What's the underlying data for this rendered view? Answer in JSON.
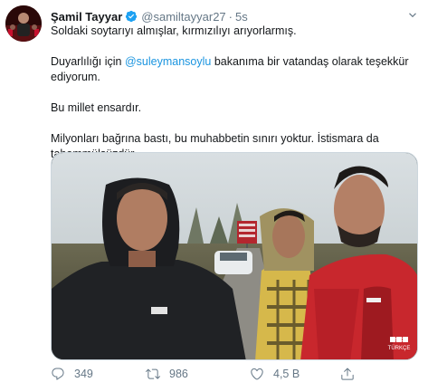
{
  "tweet": {
    "display_name": "Şamil Tayyar",
    "handle": "@samiltayyar27",
    "separator": "·",
    "time": "5s",
    "lines": {
      "l1": "Soldaki soytarıyı almışlar, kırmızılıyı arıyorlarmış.",
      "l2_prefix": "Duyarlılığı için ",
      "l2_mention": "@suleymansoylu",
      "l2_suffix": " bakanıma bir vatandaş olarak teşekkür ediyorum.",
      "l3": "Bu millet ensardır.",
      "l4": "Milyonları bağrına bastı, bu muhabbetin sınırı yoktur. İstismara da tahammülsüzdür."
    },
    "media": {
      "watermark_line1": "BBC",
      "watermark_line2": "TÜRKÇE"
    },
    "actions": {
      "replies": "349",
      "retweets": "986",
      "likes": "4,5 B"
    }
  },
  "colors": {
    "verified": "#1da1f2",
    "mention": "#1b95e0",
    "secondary_text": "#657786"
  },
  "icons": {
    "verified": "verified-badge-icon",
    "caret": "chevron-down-icon",
    "reply": "reply-icon",
    "retweet": "retweet-icon",
    "like": "heart-icon",
    "share": "share-icon"
  }
}
